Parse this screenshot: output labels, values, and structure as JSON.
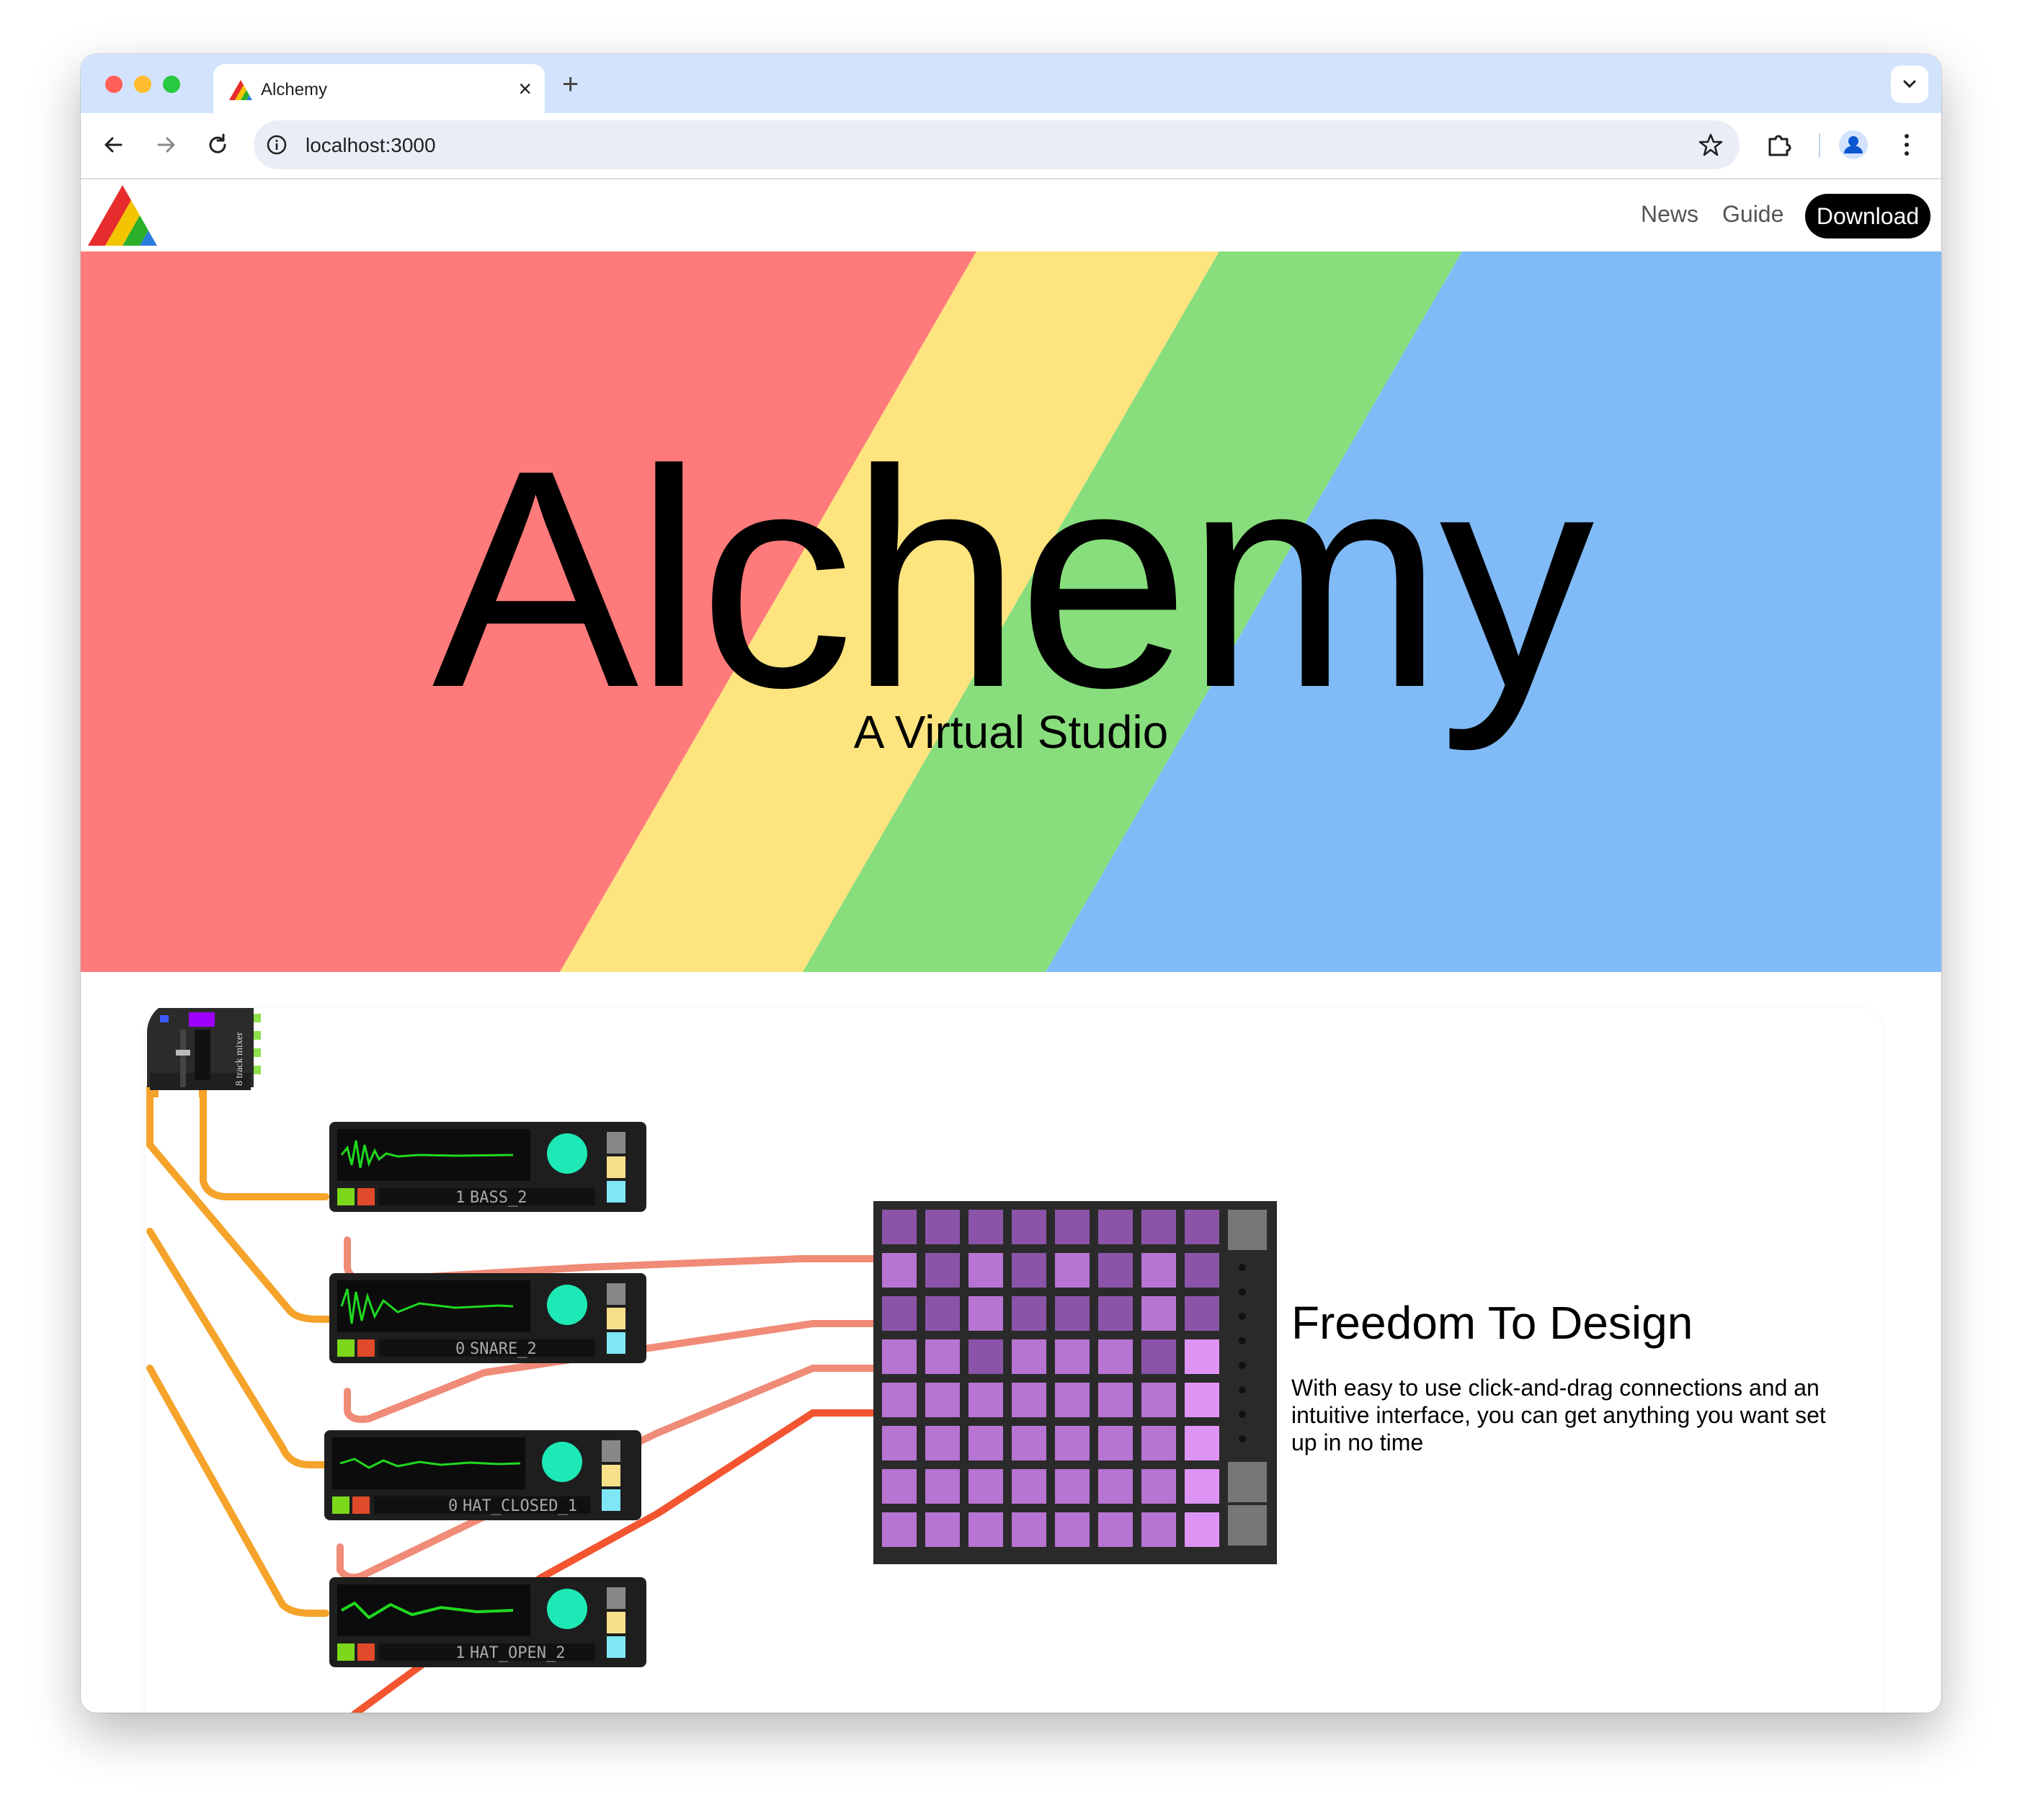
{
  "browser": {
    "tab_title": "Alchemy",
    "new_tab_label": "+",
    "close_tab_label": "×",
    "url": "localhost:3000"
  },
  "site": {
    "nav": {
      "news": "News",
      "guide": "Guide",
      "download": "Download"
    },
    "hero": {
      "title": "Alchemy",
      "subtitle": "A Virtual Studio",
      "stripe_colors": [
        "#ff7b7b",
        "#fde47f",
        "#88dd7c",
        "#80bbf7"
      ]
    },
    "feature": {
      "title": "Freedom To Design",
      "description": "With easy to use click-and-drag connections and an intuitive interface, you can get anything you want set up in no time"
    },
    "studio": {
      "mixer_label": "8 track mixer",
      "players": [
        {
          "count": "1",
          "sample": "BASS_2"
        },
        {
          "count": "0",
          "sample": "SNARE_2"
        },
        {
          "count": "0",
          "sample": "HAT_CLOSED_1"
        },
        {
          "count": "1",
          "sample": "HAT_OPEN_2"
        }
      ]
    }
  }
}
